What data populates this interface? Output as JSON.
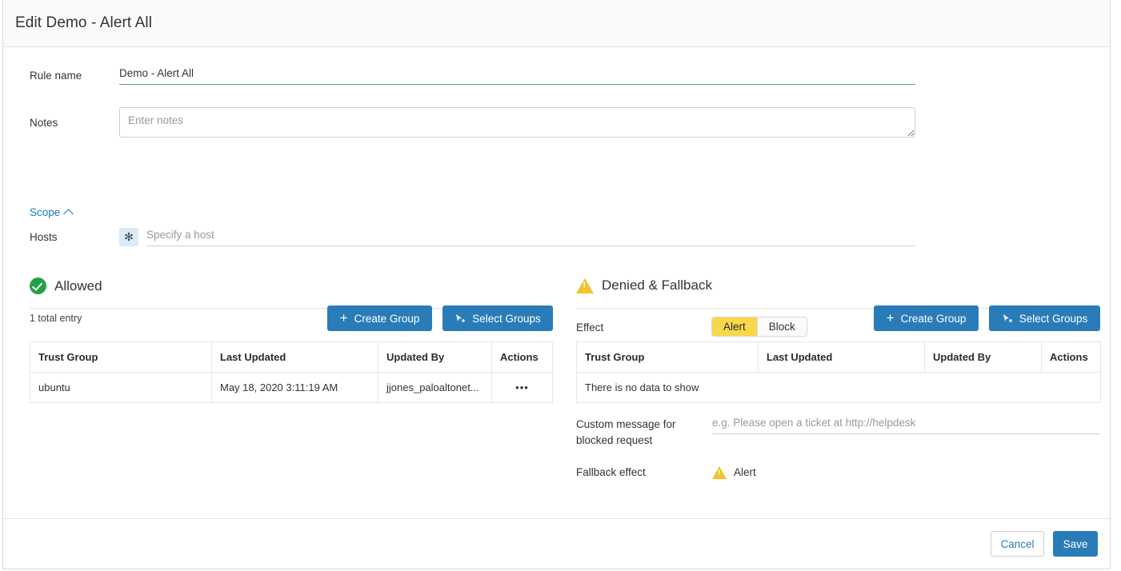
{
  "modal": {
    "title": "Edit Demo - Alert All"
  },
  "form": {
    "rule_name_label": "Rule name",
    "rule_name_value": "Demo - Alert All",
    "notes_label": "Notes",
    "notes_value": "",
    "notes_placeholder": "Enter notes",
    "scope_label": "Scope",
    "hosts_label": "Hosts",
    "hosts_badge": "✻",
    "hosts_value": "",
    "hosts_placeholder": "Specify a host"
  },
  "allowed": {
    "title": "Allowed",
    "icon": "check-circle-icon",
    "total_entry": "1 total entry",
    "create_group_label": "Create Group",
    "select_groups_label": "Select Groups",
    "table": {
      "columns": [
        "Trust Group",
        "Last Updated",
        "Updated By",
        "Actions"
      ],
      "rows": [
        {
          "trust_group": "ubuntu",
          "last_updated": "May 18, 2020 3:11:19 AM",
          "updated_by": "jjones_paloaltonet...",
          "actions": "•••"
        }
      ]
    }
  },
  "denied": {
    "title": "Denied & Fallback",
    "icon": "warning-triangle-icon",
    "effect_label": "Effect",
    "effect_options": [
      "Alert",
      "Block"
    ],
    "effect_selected": "Alert",
    "create_group_label": "Create Group",
    "select_groups_label": "Select Groups",
    "table": {
      "columns": [
        "Trust Group",
        "Last Updated",
        "Updated By",
        "Actions"
      ],
      "empty_message": "There is no data to show"
    },
    "custom_message_label": "Custom message for blocked request",
    "custom_message_value": "",
    "custom_message_placeholder": "e.g. Please open a ticket at http://helpdesk",
    "fallback_effect_label": "Fallback effect",
    "fallback_effect_value": "Alert"
  },
  "footer": {
    "cancel_label": "Cancel",
    "save_label": "Save"
  },
  "colors": {
    "primary_blue": "#2a7cb8",
    "link_blue": "#1a7bbd",
    "alert_yellow": "#f7d84a",
    "allowed_green": "#24a148",
    "warning_amber": "#f2c230",
    "input_underline": "#5d9cab"
  }
}
